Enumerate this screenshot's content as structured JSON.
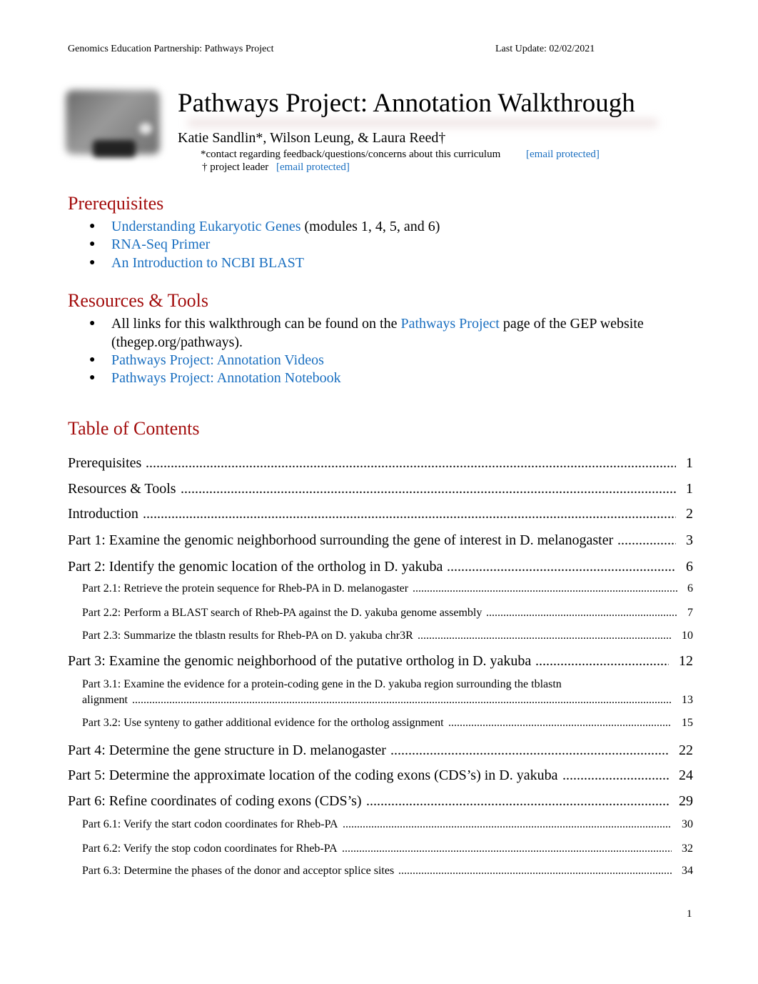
{
  "header": {
    "left": "Genomics Education Partnership: Pathways Project",
    "right": "Last Update: 02/02/2021"
  },
  "logo": {
    "name": "GEP logo (blurred)"
  },
  "title": "Pathways Project: Annotation Walkthrough",
  "authors": "Katie Sandlin*, Wilson Leung, & Laura Reed†",
  "contact_note": {
    "text": "*contact regarding feedback/questions/concerns about this curriculum",
    "email": "[email protected]"
  },
  "leader_note": {
    "text": "† project leader",
    "email": "[email protected]"
  },
  "sections": {
    "prerequisites": {
      "heading": "Prerequisites",
      "items": [
        {
          "link": "Understanding Eukaryotic Genes",
          "suffix": " (modules 1, 4, 5, and 6)"
        },
        {
          "link": "RNA-Seq Primer",
          "suffix": ""
        },
        {
          "link": "An Introduction to NCBI BLAST",
          "suffix": ""
        }
      ]
    },
    "resources": {
      "heading": "Resources & Tools",
      "items": [
        {
          "prefix": "All links for this walkthrough can be found on the ",
          "link": "Pathways Project",
          "suffix": " page of the GEP website",
          "continuation": "(thegep.org/pathways)."
        },
        {
          "link": "Pathways Project: Annotation Videos"
        },
        {
          "link": "Pathways Project: Annotation Notebook"
        }
      ]
    },
    "toc": {
      "heading": "Table of Contents",
      "entries": [
        {
          "title": "Prerequisites",
          "page": "1",
          "level": 1
        },
        {
          "title": "Resources & Tools",
          "page": "1",
          "level": 1
        },
        {
          "title": "Introduction",
          "page": "2",
          "level": 1
        },
        {
          "title": "Part 1: Examine the genomic neighborhood surrounding the gene of interest in D. melanogaster",
          "page": "3",
          "level": 1
        },
        {
          "title": "Part 2: Identify the genomic location of the ortholog in D. yakuba",
          "page": "6",
          "level": 1
        },
        {
          "title": "Part 2.1: Retrieve the protein sequence for Rheb-PA in  D. melanogaster",
          "page": "6",
          "level": 2
        },
        {
          "title": "Part 2.2: Perform a  BLAST search of Rheb-PA against the  D. yakuba genome assembly",
          "page": "7",
          "level": 2
        },
        {
          "title": "Part 2.3: Summarize the  tblastn  results for Rheb-PA on  D. yakuba  chr3R",
          "page": "10",
          "level": 2
        },
        {
          "title": "Part 3: Examine the genomic neighborhood of the putative ortholog in D. yakuba",
          "page": "12",
          "level": 1
        },
        {
          "title": "Part 3.1: Examine the evidence for a protein-coding gene in the  D. yakuba region surrounding the  tblastn",
          "continuation": "alignment",
          "page": "13",
          "level": 2
        },
        {
          "title": "Part 3.2: Use synteny to gather additional evidence for the ortholog assignment",
          "page": "15",
          "level": 2
        },
        {
          "title": "Part 4: Determine the gene structure in D. melanogaster",
          "page": "22",
          "level": 1
        },
        {
          "title": "Part 5: Determine the approximate location of the coding exons (CDS’s) in D. yakuba",
          "page": "24",
          "level": 1
        },
        {
          "title": "Part 6: Refine coordinates of coding exons (CDS’s)",
          "page": "29",
          "level": 1
        },
        {
          "title": "Part 6.1: Verify the start codon coordinates for Rheb-PA",
          "page": "30",
          "level": 2
        },
        {
          "title": "Part 6.2: Verify the stop codon coordinates for Rheb-PA",
          "page": "32",
          "level": 2
        },
        {
          "title": "Part 6.3: Determine the phases of the donor and acceptor splice sites",
          "page": "34",
          "level": 2
        }
      ]
    }
  },
  "footer": {
    "page_number": "1"
  },
  "colors": {
    "heading": "#a30d0d",
    "link": "#1a6fc0",
    "text": "#000000"
  }
}
